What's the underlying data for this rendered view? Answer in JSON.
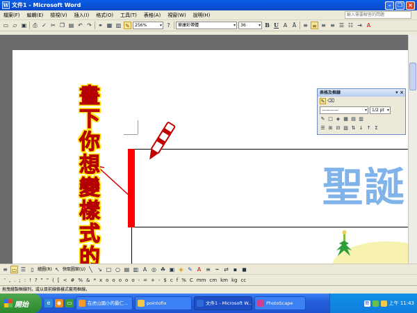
{
  "window": {
    "title": "文件1 - Microsoft Word",
    "app_icon": "W",
    "controls": [
      "minimize-icon",
      "maximize-icon",
      "close-icon"
    ]
  },
  "menu": {
    "items": [
      "檔案(F)",
      "編輯(E)",
      "檢視(V)",
      "插入(I)",
      "格式(O)",
      "工具(T)",
      "表格(A)",
      "視窗(W)",
      "說明(H)"
    ],
    "help_placeholder": "輸入需要解答的問題"
  },
  "toolbar": {
    "zoom": "256%",
    "font": "華康彩帶體",
    "font_size": "36",
    "icons": [
      "new-icon",
      "open-icon",
      "save-icon",
      "print-icon",
      "spell-icon",
      "cut-icon",
      "copy-icon",
      "paste-icon",
      "undo-icon",
      "redo-icon",
      "hyperlink-icon",
      "table-icon",
      "draw-table-icon"
    ],
    "bold": "B",
    "underline": "U",
    "italic": "A"
  },
  "document": {
    "vertical_text": "畫下你想變樣式的線條",
    "banner_text": "聖誕"
  },
  "floating_toolbar": {
    "title": "表格及框線",
    "line_weight": "1/2 pt"
  },
  "drawing_toolbar": {
    "draw_label": "繪圖(R)",
    "autoshape_label": "快取圖案(U)"
  },
  "symbols": [
    "'",
    ",",
    ".",
    ";",
    ":",
    "!",
    "?",
    "\"",
    "\"",
    "(",
    "[",
    "<",
    "#",
    "%",
    "&",
    "*",
    "x",
    "o",
    "o",
    "o",
    "o",
    "o",
    "-",
    "=",
    "+",
    "-",
    "$",
    "c",
    "f",
    "%",
    "C",
    "mm",
    "cm",
    "km",
    "kg",
    "cc"
  ],
  "statusbar": {
    "text": "拖曳繪製框線列，或以目前線條樣式套用框線。"
  },
  "taskbar": {
    "start_label": "開始",
    "tasks": [
      {
        "label": "在虎山國小的最仁...",
        "color": "#f29a2c"
      },
      {
        "label": "pointofix",
        "color": "#f3c74b"
      },
      {
        "label": "文件1 - Microsoft W...",
        "color": "#2c6ad8"
      },
      {
        "label": "PhotoScape",
        "color": "#d04090"
      }
    ],
    "clock": "上午 11:43",
    "ime": "簡"
  }
}
